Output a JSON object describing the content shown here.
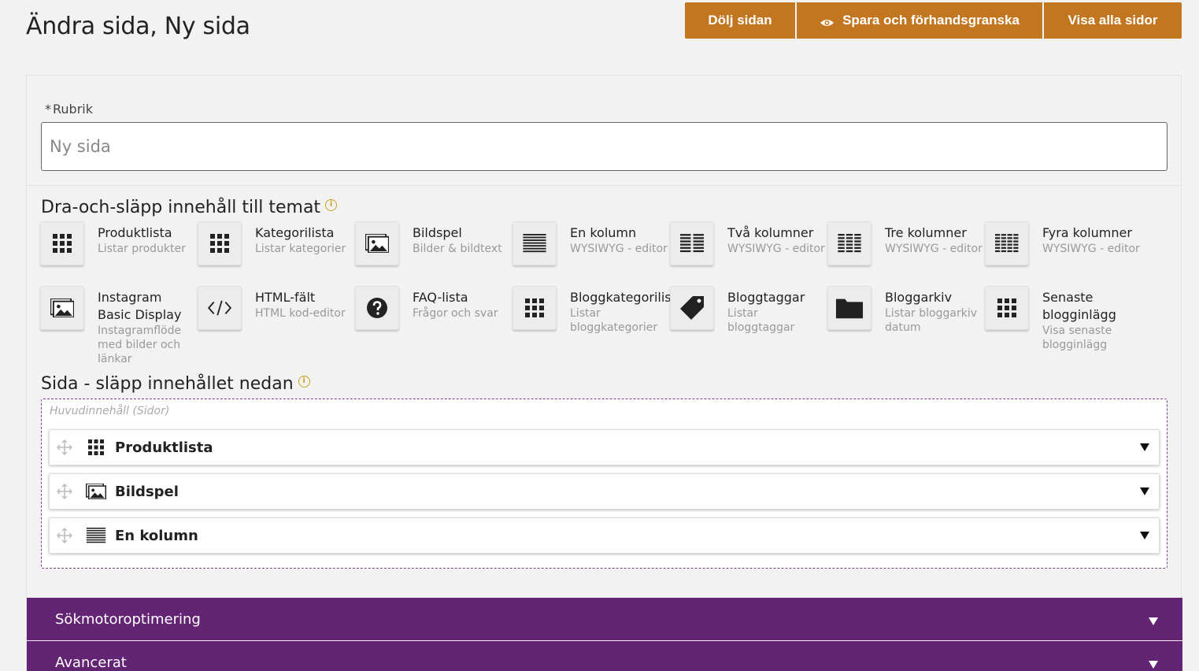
{
  "page": {
    "title": "Ändra sida, Ny sida"
  },
  "toolbar": {
    "hide_label": "Dölj sidan",
    "save_label": "Spara och förhandsgranska",
    "all_label": "Visa alla sidor",
    "accent_color": "#c37620"
  },
  "form": {
    "required_mark": "*",
    "rubrik_label": "Rubrik",
    "rubrik_placeholder": "Ny sida"
  },
  "palette": {
    "title": "Dra-och-släpp innehåll till temat",
    "info": "i",
    "widgets": [
      {
        "icon": "grid-icon",
        "title": "Produktlista",
        "sub": "Listar produkter"
      },
      {
        "icon": "grid-icon",
        "title": "Kategorilista",
        "sub": "Listar kategorier"
      },
      {
        "icon": "image-icon",
        "title": "Bildspel",
        "sub": "Bilder & bildtext"
      },
      {
        "icon": "one-column-icon",
        "title": "En kolumn",
        "sub": "WYSIWYG - editor"
      },
      {
        "icon": "two-columns-icon",
        "title": "Två kolumner",
        "sub": "WYSIWYG - editor"
      },
      {
        "icon": "three-columns-icon",
        "title": "Tre kolumner",
        "sub": "WYSIWYG - editor"
      },
      {
        "icon": "four-columns-icon",
        "title": "Fyra kolumner",
        "sub": "WYSIWYG - editor"
      },
      {
        "icon": "image-icon",
        "title": "Instagram Basic Display",
        "sub": "Instagramflöde med bilder och länkar"
      },
      {
        "icon": "code-icon",
        "title": "HTML-fält",
        "sub": "HTML kod-editor"
      },
      {
        "icon": "question-icon",
        "title": "FAQ-lista",
        "sub": "Frågor och svar"
      },
      {
        "icon": "grid-icon",
        "title": "Bloggkategorilist",
        "sub": "Listar bloggkategorier"
      },
      {
        "icon": "tag-icon",
        "title": "Bloggtaggar",
        "sub": "Listar bloggtaggar"
      },
      {
        "icon": "folder-icon",
        "title": "Bloggarkiv",
        "sub": "Listar bloggarkiv datum"
      },
      {
        "icon": "grid-icon",
        "title": "Senaste blogginlägg",
        "sub": "Visa senaste blogginlägg"
      }
    ]
  },
  "page_content": {
    "title": "Sida - släpp innehållet nedan",
    "info": "i",
    "zone_label": "Huvudinnehåll (Sidor)",
    "blocks": [
      {
        "icon": "grid-icon",
        "title": "Produktlista"
      },
      {
        "icon": "image-icon",
        "title": "Bildspel"
      },
      {
        "icon": "one-column-icon",
        "title": "En kolumn"
      }
    ]
  },
  "accordions": [
    {
      "label": "Sökmotoroptimering"
    },
    {
      "label": "Avancerat"
    }
  ],
  "colors": {
    "accordion_bg": "#632474",
    "dropzone_border": "#7a3a8a"
  }
}
